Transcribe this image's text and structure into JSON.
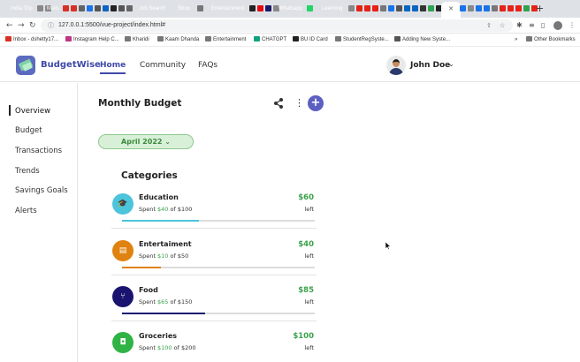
{
  "browser": {
    "tab_groups": [
      {
        "label": "India Trip",
        "color": "#1a7a6c"
      },
      {
        "label": "Mails",
        "color": "#8e3fc7"
      },
      {
        "label": "Job Search",
        "color": "#1a73e8"
      },
      {
        "label": "Shop",
        "color": "#d93025"
      },
      {
        "label": "Entertainment",
        "color": "#1e8e3e"
      },
      {
        "label": "Whatsapp",
        "color": "#5f6368"
      },
      {
        "label": "Learning",
        "color": "#c5221f"
      }
    ],
    "active_tab_icon": "close-icon",
    "url": "127.0.0.1:5500/vue-project/index.html#",
    "bookmarks": [
      {
        "label": "Inbox - dshetty17...",
        "color": "#d93025"
      },
      {
        "label": "Instagram Help C...",
        "color": "#c13584"
      },
      {
        "label": "Kharidi",
        "color": "#777777"
      },
      {
        "label": "Kaam Dhanda",
        "color": "#777777"
      },
      {
        "label": "Entertainment",
        "color": "#777777"
      },
      {
        "label": "CHATGPT",
        "color": "#10a37f"
      },
      {
        "label": "BU ID Card",
        "color": "#222222"
      },
      {
        "label": "StudentRegSyste...",
        "color": "#777777"
      },
      {
        "label": "Adding New Syste...",
        "color": "#555555"
      }
    ],
    "other_bookmarks": "Other Bookmarks"
  },
  "app": {
    "brand": "BudgetWise",
    "nav": {
      "home": "Home",
      "community": "Community",
      "faqs": "FAQs"
    },
    "user": {
      "name": "John Doe"
    },
    "accent": "#3f4aa8"
  },
  "sidebar": {
    "items": [
      {
        "label": "Overview",
        "active": true
      },
      {
        "label": "Budget"
      },
      {
        "label": "Transactions"
      },
      {
        "label": "Trends"
      },
      {
        "label": "Savings Goals"
      },
      {
        "label": "Alerts"
      }
    ]
  },
  "main": {
    "title": "Monthly Budget",
    "month": "April 2022",
    "categories_title": "Categories",
    "left_label": "left",
    "categories": [
      {
        "name": "Education",
        "spent_prefix": "Spent",
        "spent": "$40",
        "of": "of $100",
        "left": "$60",
        "progress": 0.4,
        "color": "#4cc4dc",
        "icon": "graduation-cap-icon",
        "glyph": "🎓"
      },
      {
        "name": "Entertaiment",
        "spent_prefix": "Spent",
        "spent": "$10",
        "of": "of $50",
        "left": "$40",
        "progress": 0.2,
        "color": "#e0820f",
        "icon": "ticket-icon",
        "glyph": "▤"
      },
      {
        "name": "Food",
        "spent_prefix": "Spent",
        "spent": "$65",
        "of": "of $150",
        "left": "$85",
        "progress": 0.43,
        "color": "#1a1470",
        "icon": "fork-knife-icon",
        "glyph": "⑂"
      },
      {
        "name": "Groceries",
        "spent_prefix": "Spent",
        "spent": "$100",
        "of": "of $200",
        "left": "$100",
        "progress": 0.5,
        "color": "#2fb344",
        "icon": "shopping-bag-icon",
        "glyph": "◘"
      }
    ]
  }
}
